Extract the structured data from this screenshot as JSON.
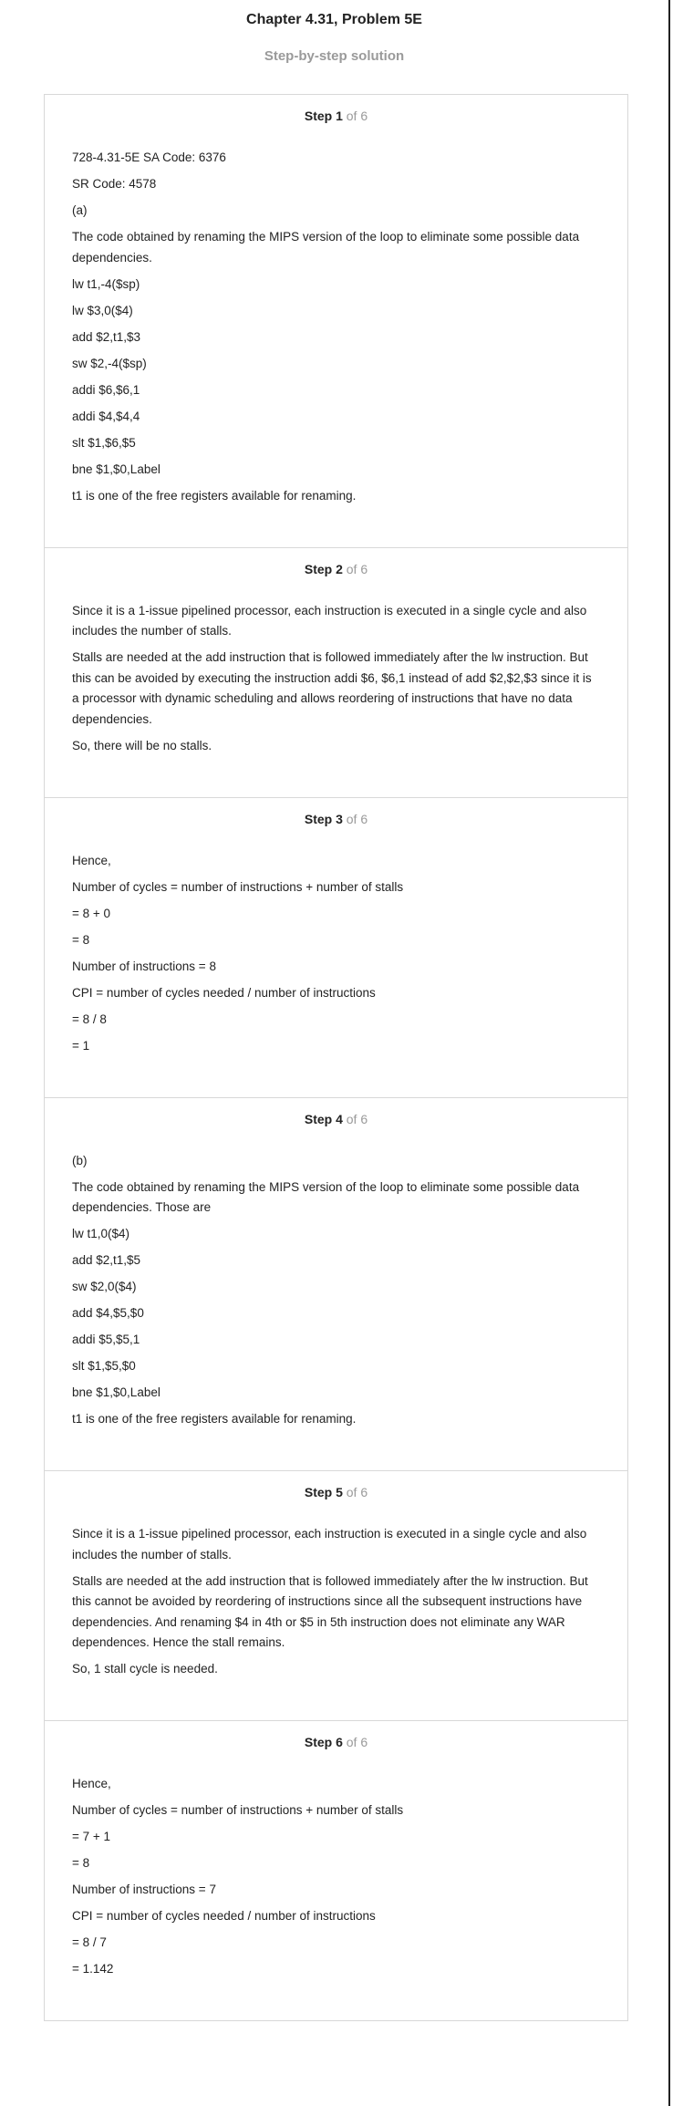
{
  "header": {
    "title": "Chapter 4.31, Problem 5E",
    "subtitle": "Step-by-step solution"
  },
  "steps": [
    {
      "label": "Step 1",
      "of": "of 6",
      "lines": [
        "728-4.31-5E SA Code: 6376",
        "SR Code: 4578",
        "(a)",
        "The code obtained by renaming the MIPS version of the loop to eliminate some possible data dependencies.",
        "lw t1,-4($sp)",
        "lw $3,0($4)",
        "add $2,t1,$3",
        "sw $2,-4($sp)",
        "addi $6,$6,1",
        "addi $4,$4,4",
        "slt $1,$6,$5",
        "bne $1,$0,Label",
        "t1 is one of the free registers available for renaming."
      ]
    },
    {
      "label": "Step 2",
      "of": "of 6",
      "lines": [
        "Since it is a 1-issue pipelined processor, each instruction is executed in a single cycle and also includes the number of stalls.",
        "Stalls are needed at the add instruction that is followed immediately after the lw instruction. But this can be avoided by executing the instruction addi $6, $6,1 instead of add $2,$2,$3 since it is a processor with dynamic scheduling and allows reordering of instructions that have no data dependencies.",
        "So, there will be no stalls."
      ]
    },
    {
      "label": "Step 3",
      "of": "of 6",
      "lines": [
        "Hence,",
        "Number of cycles = number of instructions + number of stalls",
        "= 8 + 0",
        "= 8",
        "Number of instructions = 8",
        "CPI = number of cycles needed / number of instructions",
        "= 8 / 8",
        "= 1"
      ]
    },
    {
      "label": "Step 4",
      "of": "of 6",
      "lines": [
        "(b)",
        "The code obtained by renaming the MIPS version of the loop to eliminate some possible data dependencies. Those are",
        "lw t1,0($4)",
        "add $2,t1,$5",
        "sw $2,0($4)",
        "add $4,$5,$0",
        "addi $5,$5,1",
        "slt $1,$5,$0",
        "bne $1,$0,Label",
        "t1 is one of the free registers available for renaming."
      ]
    },
    {
      "label": "Step 5",
      "of": "of 6",
      "lines": [
        "Since it is a 1-issue pipelined processor, each instruction is executed in a single cycle and also includes the number of stalls.",
        "Stalls are needed at the add instruction that is followed immediately after the lw instruction. But this cannot be avoided by reordering of instructions since all the subsequent instructions have dependencies. And renaming $4 in 4th or $5 in 5th instruction does not eliminate any WAR dependences. Hence the stall remains.",
        "So, 1 stall cycle is needed."
      ]
    },
    {
      "label": "Step 6",
      "of": "of 6",
      "lines": [
        "Hence,",
        "Number of cycles = number of instructions + number of stalls",
        "= 7 + 1",
        "= 8",
        "Number of instructions = 7",
        "CPI = number of cycles needed / number of instructions",
        "= 8 / 7",
        "= 1.142"
      ]
    }
  ]
}
